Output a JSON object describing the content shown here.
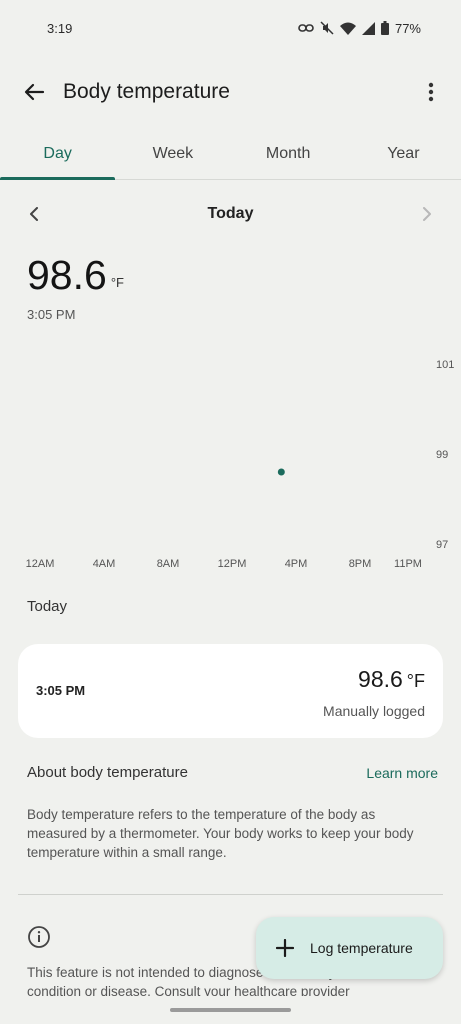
{
  "status_bar": {
    "time": "3:19",
    "battery": "77%"
  },
  "app_bar": {
    "title": "Body temperature"
  },
  "tabs": [
    {
      "label": "Day",
      "active": true
    },
    {
      "label": "Week",
      "active": false
    },
    {
      "label": "Month",
      "active": false
    },
    {
      "label": "Year",
      "active": false
    }
  ],
  "date_nav": {
    "label": "Today"
  },
  "current_reading": {
    "value": "98.6",
    "unit": "°F",
    "time": "3:05 PM"
  },
  "chart_data": {
    "type": "scatter",
    "x_ticks": [
      "12AM",
      "4AM",
      "8AM",
      "12PM",
      "4PM",
      "8PM",
      "11PM"
    ],
    "y_ticks": [
      101,
      99,
      97
    ],
    "ylim": [
      97,
      101
    ],
    "xlim_hours": [
      0,
      23
    ],
    "points": [
      {
        "x_hour": 15.083,
        "y": 98.6
      }
    ],
    "point_color": "#1b6b5c",
    "grid": false
  },
  "entries_section": {
    "title": "Today"
  },
  "entries": [
    {
      "time": "3:05 PM",
      "value": "98.6",
      "unit": "°F",
      "source": "Manually logged"
    }
  ],
  "about": {
    "title": "About body temperature",
    "link": "Learn more",
    "body": "Body temperature refers to the temperature of the body as measured by a thermometer. Your body works to keep your body temperature within a small range."
  },
  "disclaimer": "This feature is not intended to diagnose or treat any medical condition or disease. Consult your healthcare provider",
  "fab": {
    "label": "Log temperature"
  },
  "colors": {
    "accent": "#1b6b5c",
    "background": "#f0f1ee",
    "fab": "#d6ece6"
  }
}
